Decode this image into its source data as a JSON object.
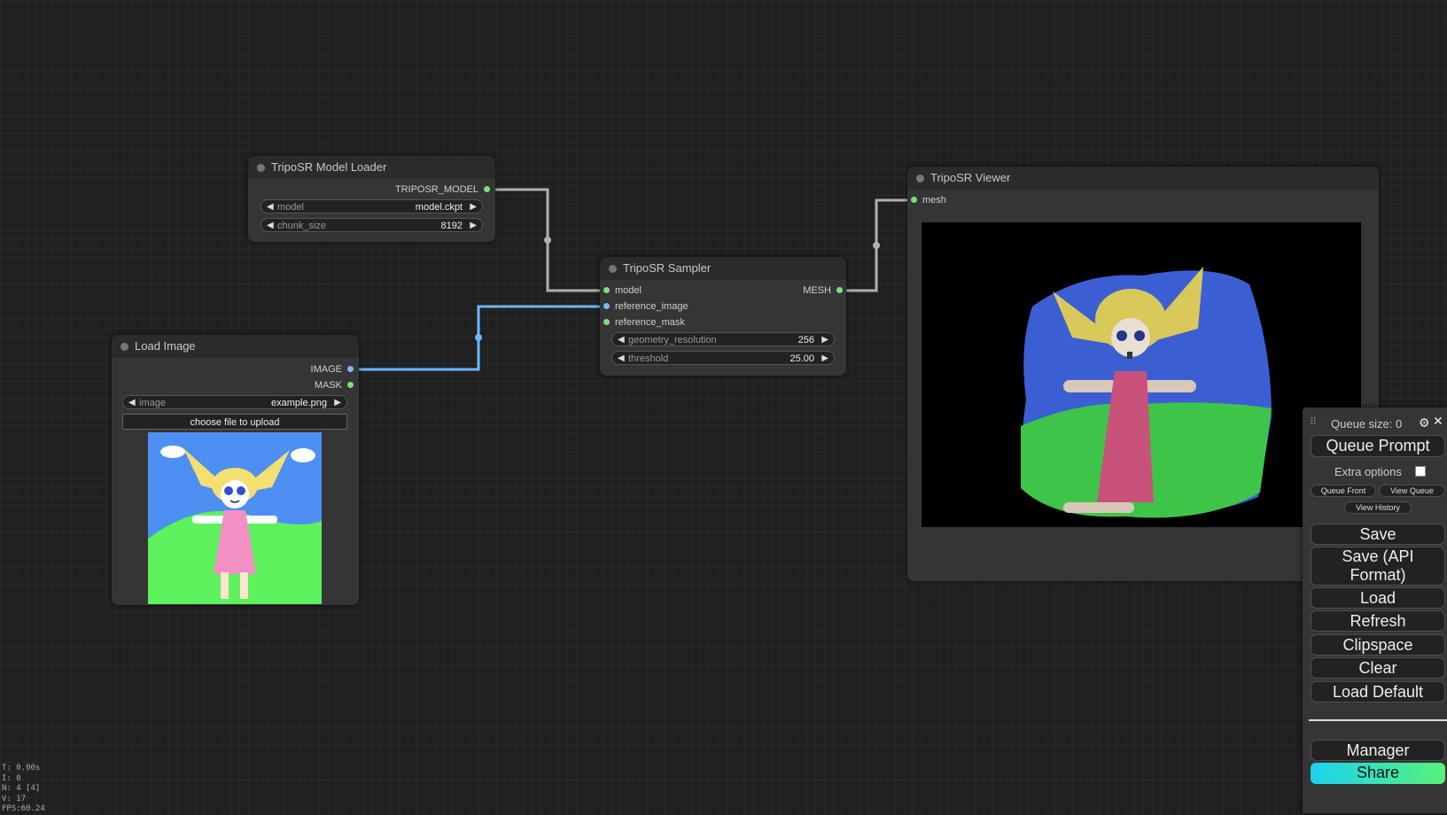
{
  "colors": {
    "link_model": "#b0b0b0",
    "link_image": "#6fb6ff",
    "share_gradient_start": "#1ad3f0",
    "share_gradient_end": "#5af07a"
  },
  "nodes": {
    "model_loader": {
      "title": "TripoSR Model Loader",
      "output": "TRIPOSR_MODEL",
      "widgets": [
        {
          "label": "model",
          "value": "model.ckpt"
        },
        {
          "label": "chunk_size",
          "value": "8192"
        }
      ]
    },
    "load_image": {
      "title": "Load Image",
      "outputs": [
        "IMAGE",
        "MASK"
      ],
      "widgets": [
        {
          "label": "image",
          "value": "example.png"
        }
      ],
      "upload_label": "choose file to upload"
    },
    "sampler": {
      "title": "TripoSR Sampler",
      "inputs": [
        "model",
        "reference_image",
        "reference_mask"
      ],
      "output": "MESH",
      "widgets": [
        {
          "label": "geometry_resolution",
          "value": "256"
        },
        {
          "label": "threshold",
          "value": "25.00"
        }
      ]
    },
    "viewer": {
      "title": "TripoSR Viewer",
      "input": "mesh"
    }
  },
  "menu": {
    "queue_size": "Queue size: 0",
    "queue_prompt": "Queue Prompt",
    "extra_options": "Extra options",
    "queue_front": "Queue Front",
    "view_queue": "View Queue",
    "view_history": "View History",
    "save": "Save",
    "save_api": "Save (API Format)",
    "load": "Load",
    "refresh": "Refresh",
    "clipspace": "Clipspace",
    "clear": "Clear",
    "load_default": "Load Default",
    "manager": "Manager",
    "share": "Share"
  },
  "stats": [
    "T: 0.00s",
    "I: 0",
    "N: 4 [4]",
    "V: 17",
    "FPS:60.24"
  ]
}
